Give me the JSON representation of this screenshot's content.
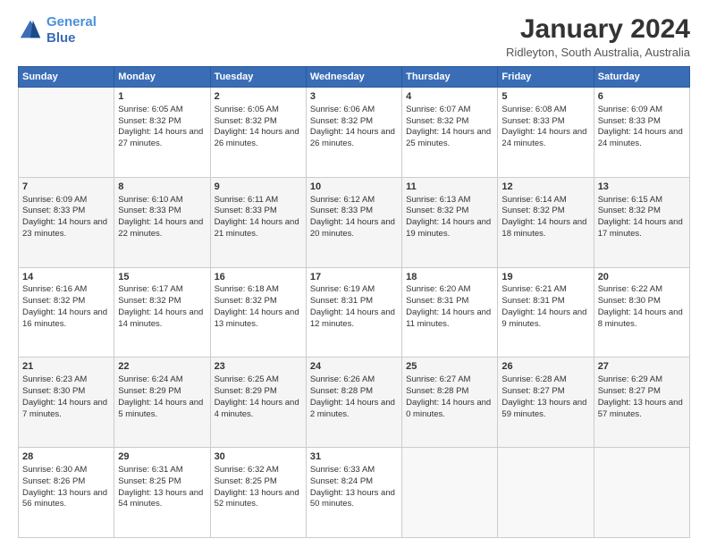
{
  "logo": {
    "line1": "General",
    "line2": "Blue"
  },
  "title": "January 2024",
  "subtitle": "Ridleyton, South Australia, Australia",
  "days_of_week": [
    "Sunday",
    "Monday",
    "Tuesday",
    "Wednesday",
    "Thursday",
    "Friday",
    "Saturday"
  ],
  "weeks": [
    {
      "shaded": false,
      "days": [
        {
          "num": "",
          "sunrise": "",
          "sunset": "",
          "daylight": "",
          "empty": true
        },
        {
          "num": "1",
          "sunrise": "Sunrise: 6:05 AM",
          "sunset": "Sunset: 8:32 PM",
          "daylight": "Daylight: 14 hours and 27 minutes."
        },
        {
          "num": "2",
          "sunrise": "Sunrise: 6:05 AM",
          "sunset": "Sunset: 8:32 PM",
          "daylight": "Daylight: 14 hours and 26 minutes."
        },
        {
          "num": "3",
          "sunrise": "Sunrise: 6:06 AM",
          "sunset": "Sunset: 8:32 PM",
          "daylight": "Daylight: 14 hours and 26 minutes."
        },
        {
          "num": "4",
          "sunrise": "Sunrise: 6:07 AM",
          "sunset": "Sunset: 8:32 PM",
          "daylight": "Daylight: 14 hours and 25 minutes."
        },
        {
          "num": "5",
          "sunrise": "Sunrise: 6:08 AM",
          "sunset": "Sunset: 8:33 PM",
          "daylight": "Daylight: 14 hours and 24 minutes."
        },
        {
          "num": "6",
          "sunrise": "Sunrise: 6:09 AM",
          "sunset": "Sunset: 8:33 PM",
          "daylight": "Daylight: 14 hours and 24 minutes."
        }
      ]
    },
    {
      "shaded": true,
      "days": [
        {
          "num": "7",
          "sunrise": "Sunrise: 6:09 AM",
          "sunset": "Sunset: 8:33 PM",
          "daylight": "Daylight: 14 hours and 23 minutes."
        },
        {
          "num": "8",
          "sunrise": "Sunrise: 6:10 AM",
          "sunset": "Sunset: 8:33 PM",
          "daylight": "Daylight: 14 hours and 22 minutes."
        },
        {
          "num": "9",
          "sunrise": "Sunrise: 6:11 AM",
          "sunset": "Sunset: 8:33 PM",
          "daylight": "Daylight: 14 hours and 21 minutes."
        },
        {
          "num": "10",
          "sunrise": "Sunrise: 6:12 AM",
          "sunset": "Sunset: 8:33 PM",
          "daylight": "Daylight: 14 hours and 20 minutes."
        },
        {
          "num": "11",
          "sunrise": "Sunrise: 6:13 AM",
          "sunset": "Sunset: 8:32 PM",
          "daylight": "Daylight: 14 hours and 19 minutes."
        },
        {
          "num": "12",
          "sunrise": "Sunrise: 6:14 AM",
          "sunset": "Sunset: 8:32 PM",
          "daylight": "Daylight: 14 hours and 18 minutes."
        },
        {
          "num": "13",
          "sunrise": "Sunrise: 6:15 AM",
          "sunset": "Sunset: 8:32 PM",
          "daylight": "Daylight: 14 hours and 17 minutes."
        }
      ]
    },
    {
      "shaded": false,
      "days": [
        {
          "num": "14",
          "sunrise": "Sunrise: 6:16 AM",
          "sunset": "Sunset: 8:32 PM",
          "daylight": "Daylight: 14 hours and 16 minutes."
        },
        {
          "num": "15",
          "sunrise": "Sunrise: 6:17 AM",
          "sunset": "Sunset: 8:32 PM",
          "daylight": "Daylight: 14 hours and 14 minutes."
        },
        {
          "num": "16",
          "sunrise": "Sunrise: 6:18 AM",
          "sunset": "Sunset: 8:32 PM",
          "daylight": "Daylight: 14 hours and 13 minutes."
        },
        {
          "num": "17",
          "sunrise": "Sunrise: 6:19 AM",
          "sunset": "Sunset: 8:31 PM",
          "daylight": "Daylight: 14 hours and 12 minutes."
        },
        {
          "num": "18",
          "sunrise": "Sunrise: 6:20 AM",
          "sunset": "Sunset: 8:31 PM",
          "daylight": "Daylight: 14 hours and 11 minutes."
        },
        {
          "num": "19",
          "sunrise": "Sunrise: 6:21 AM",
          "sunset": "Sunset: 8:31 PM",
          "daylight": "Daylight: 14 hours and 9 minutes."
        },
        {
          "num": "20",
          "sunrise": "Sunrise: 6:22 AM",
          "sunset": "Sunset: 8:30 PM",
          "daylight": "Daylight: 14 hours and 8 minutes."
        }
      ]
    },
    {
      "shaded": true,
      "days": [
        {
          "num": "21",
          "sunrise": "Sunrise: 6:23 AM",
          "sunset": "Sunset: 8:30 PM",
          "daylight": "Daylight: 14 hours and 7 minutes."
        },
        {
          "num": "22",
          "sunrise": "Sunrise: 6:24 AM",
          "sunset": "Sunset: 8:29 PM",
          "daylight": "Daylight: 14 hours and 5 minutes."
        },
        {
          "num": "23",
          "sunrise": "Sunrise: 6:25 AM",
          "sunset": "Sunset: 8:29 PM",
          "daylight": "Daylight: 14 hours and 4 minutes."
        },
        {
          "num": "24",
          "sunrise": "Sunrise: 6:26 AM",
          "sunset": "Sunset: 8:28 PM",
          "daylight": "Daylight: 14 hours and 2 minutes."
        },
        {
          "num": "25",
          "sunrise": "Sunrise: 6:27 AM",
          "sunset": "Sunset: 8:28 PM",
          "daylight": "Daylight: 14 hours and 0 minutes."
        },
        {
          "num": "26",
          "sunrise": "Sunrise: 6:28 AM",
          "sunset": "Sunset: 8:27 PM",
          "daylight": "Daylight: 13 hours and 59 minutes."
        },
        {
          "num": "27",
          "sunrise": "Sunrise: 6:29 AM",
          "sunset": "Sunset: 8:27 PM",
          "daylight": "Daylight: 13 hours and 57 minutes."
        }
      ]
    },
    {
      "shaded": false,
      "days": [
        {
          "num": "28",
          "sunrise": "Sunrise: 6:30 AM",
          "sunset": "Sunset: 8:26 PM",
          "daylight": "Daylight: 13 hours and 56 minutes."
        },
        {
          "num": "29",
          "sunrise": "Sunrise: 6:31 AM",
          "sunset": "Sunset: 8:25 PM",
          "daylight": "Daylight: 13 hours and 54 minutes."
        },
        {
          "num": "30",
          "sunrise": "Sunrise: 6:32 AM",
          "sunset": "Sunset: 8:25 PM",
          "daylight": "Daylight: 13 hours and 52 minutes."
        },
        {
          "num": "31",
          "sunrise": "Sunrise: 6:33 AM",
          "sunset": "Sunset: 8:24 PM",
          "daylight": "Daylight: 13 hours and 50 minutes."
        },
        {
          "num": "",
          "sunrise": "",
          "sunset": "",
          "daylight": "",
          "empty": true
        },
        {
          "num": "",
          "sunrise": "",
          "sunset": "",
          "daylight": "",
          "empty": true
        },
        {
          "num": "",
          "sunrise": "",
          "sunset": "",
          "daylight": "",
          "empty": true
        }
      ]
    }
  ]
}
